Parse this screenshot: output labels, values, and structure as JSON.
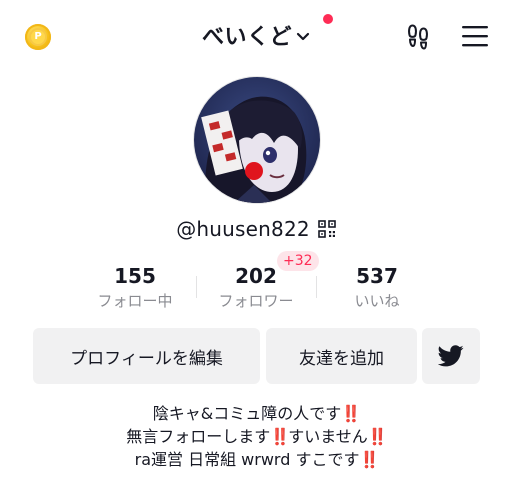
{
  "header": {
    "title": "べいくど",
    "coin_icon": "coin-icon",
    "coin_glyph": "P",
    "notification_color": "#fe2c55",
    "footprint_icon": "footprint-icon",
    "menu_icon": "hamburger-menu-icon"
  },
  "profile": {
    "avatar_icon": "avatar-image",
    "username": "@huusen822",
    "qr_icon": "qr-code-icon"
  },
  "stats": {
    "following": {
      "value": "155",
      "label": "フォロー中"
    },
    "followers": {
      "value": "202",
      "label": "フォロワー",
      "badge": "+32"
    },
    "likes": {
      "value": "537",
      "label": "いいね"
    }
  },
  "buttons": {
    "edit_profile": "プロフィールを編集",
    "add_friends": "友達を追加",
    "twitter_icon": "twitter-bird-icon"
  },
  "bio": {
    "line1": "陰キャ&コミュ障の人です",
    "line2a": "無言フォローします",
    "line2b": "すいません",
    "line3": "ra運営 日常組 wrwrd すこです",
    "emphasis": "‼️"
  },
  "colors": {
    "accent": "#fe2c55",
    "button_bg": "#f1f1f2",
    "secondary_text": "#8a8b91"
  }
}
